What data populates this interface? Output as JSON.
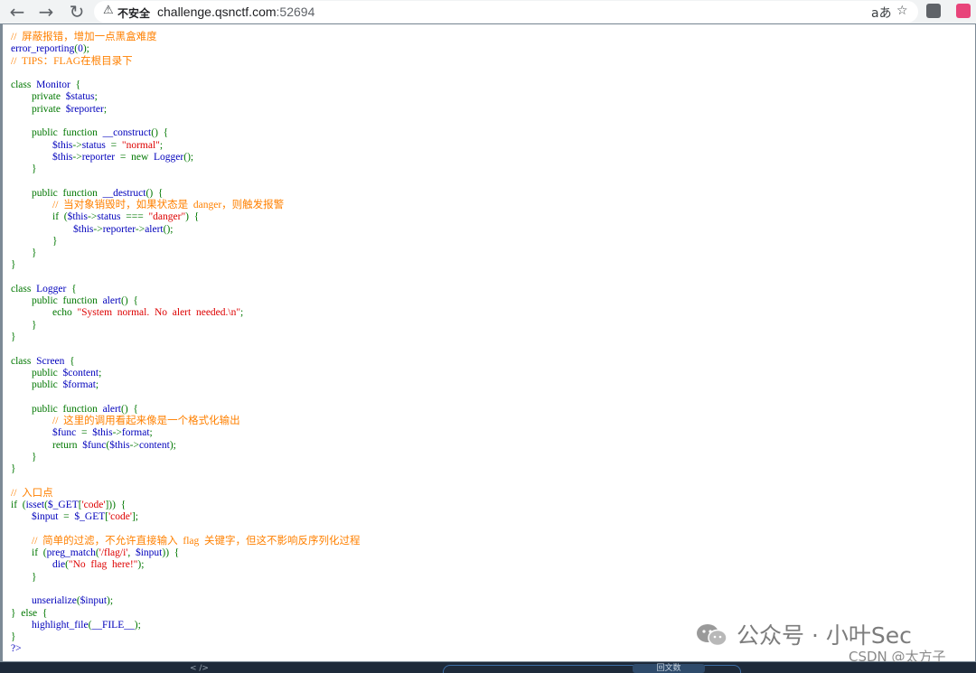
{
  "browser": {
    "security_label": "不安全",
    "url_host": "challenge.qsnctf.com",
    "url_port": ":52694",
    "translate_icon": "translate-icon",
    "bookmark_icon": "star-icon"
  },
  "code_lines": [
    [
      [
        "cm",
        "//  屏蔽报错，增加一点黑盒难度"
      ]
    ],
    [
      [
        "df",
        "error_reporting"
      ],
      [
        "kw",
        "("
      ],
      [
        "df",
        "0"
      ],
      [
        "kw",
        ");"
      ]
    ],
    [
      [
        "cm",
        "//  TIPS：FLAG在根目录下"
      ]
    ],
    [],
    [
      [
        "kw",
        "class  "
      ],
      [
        "df",
        "Monitor  "
      ],
      [
        "kw",
        "{"
      ]
    ],
    [
      [
        "kw",
        "        private  "
      ],
      [
        "df",
        "$status"
      ],
      [
        "kw",
        ";"
      ]
    ],
    [
      [
        "kw",
        "        private  "
      ],
      [
        "df",
        "$reporter"
      ],
      [
        "kw",
        ";"
      ]
    ],
    [],
    [
      [
        "kw",
        "        public  function  "
      ],
      [
        "df",
        "__construct"
      ],
      [
        "kw",
        "()  {"
      ]
    ],
    [
      [
        "df",
        "                $this"
      ],
      [
        "kw",
        "->"
      ],
      [
        "df",
        "status  "
      ],
      [
        "kw",
        "=  "
      ],
      [
        "st",
        "\"normal\""
      ],
      [
        "kw",
        ";"
      ]
    ],
    [
      [
        "df",
        "                $this"
      ],
      [
        "kw",
        "->"
      ],
      [
        "df",
        "reporter  "
      ],
      [
        "kw",
        "=  new  "
      ],
      [
        "df",
        "Logger"
      ],
      [
        "kw",
        "();"
      ]
    ],
    [
      [
        "kw",
        "        }"
      ]
    ],
    [],
    [
      [
        "kw",
        "        public  function  "
      ],
      [
        "df",
        "__destruct"
      ],
      [
        "kw",
        "()  {"
      ]
    ],
    [
      [
        "cm",
        "                //  当对象销毁时，如果状态是  danger，则触发报警"
      ]
    ],
    [
      [
        "kw",
        "                if  ("
      ],
      [
        "df",
        "$this"
      ],
      [
        "kw",
        "->"
      ],
      [
        "df",
        "status  "
      ],
      [
        "kw",
        "===  "
      ],
      [
        "st",
        "\"danger\""
      ],
      [
        "kw",
        ")  {"
      ]
    ],
    [
      [
        "df",
        "                        $this"
      ],
      [
        "kw",
        "->"
      ],
      [
        "df",
        "reporter"
      ],
      [
        "kw",
        "->"
      ],
      [
        "df",
        "alert"
      ],
      [
        "kw",
        "();"
      ]
    ],
    [
      [
        "kw",
        "                }"
      ]
    ],
    [
      [
        "kw",
        "        }"
      ]
    ],
    [
      [
        "kw",
        "}"
      ]
    ],
    [],
    [
      [
        "kw",
        "class  "
      ],
      [
        "df",
        "Logger  "
      ],
      [
        "kw",
        "{"
      ]
    ],
    [
      [
        "kw",
        "        public  function  "
      ],
      [
        "df",
        "alert"
      ],
      [
        "kw",
        "()  {"
      ]
    ],
    [
      [
        "kw",
        "                echo  "
      ],
      [
        "st",
        "\"System  normal.  No  alert  needed.\\n\""
      ],
      [
        "kw",
        ";"
      ]
    ],
    [
      [
        "kw",
        "        }"
      ]
    ],
    [
      [
        "kw",
        "}"
      ]
    ],
    [],
    [
      [
        "kw",
        "class  "
      ],
      [
        "df",
        "Screen  "
      ],
      [
        "kw",
        "{"
      ]
    ],
    [
      [
        "kw",
        "        public  "
      ],
      [
        "df",
        "$content"
      ],
      [
        "kw",
        ";"
      ]
    ],
    [
      [
        "kw",
        "        public  "
      ],
      [
        "df",
        "$format"
      ],
      [
        "kw",
        ";"
      ]
    ],
    [],
    [
      [
        "kw",
        "        public  function  "
      ],
      [
        "df",
        "alert"
      ],
      [
        "kw",
        "()  {"
      ]
    ],
    [
      [
        "cm",
        "                //  这里的调用看起来像是一个格式化输出"
      ]
    ],
    [
      [
        "df",
        "                $func  "
      ],
      [
        "kw",
        "=  "
      ],
      [
        "df",
        "$this"
      ],
      [
        "kw",
        "->"
      ],
      [
        "df",
        "format"
      ],
      [
        "kw",
        ";"
      ]
    ],
    [
      [
        "kw",
        "                return  "
      ],
      [
        "df",
        "$func"
      ],
      [
        "kw",
        "("
      ],
      [
        "df",
        "$this"
      ],
      [
        "kw",
        "->"
      ],
      [
        "df",
        "content"
      ],
      [
        "kw",
        ");"
      ]
    ],
    [
      [
        "kw",
        "        }"
      ]
    ],
    [
      [
        "kw",
        "}"
      ]
    ],
    [],
    [
      [
        "cm",
        "//  入口点"
      ]
    ],
    [
      [
        "kw",
        "if  ("
      ],
      [
        "df",
        "isset"
      ],
      [
        "kw",
        "("
      ],
      [
        "df",
        "$_GET"
      ],
      [
        "kw",
        "["
      ],
      [
        "st",
        "'code'"
      ],
      [
        "kw",
        "]))  {"
      ]
    ],
    [
      [
        "df",
        "        $input  "
      ],
      [
        "kw",
        "=  "
      ],
      [
        "df",
        "$_GET"
      ],
      [
        "kw",
        "["
      ],
      [
        "st",
        "'code'"
      ],
      [
        "kw",
        "];"
      ]
    ],
    [],
    [
      [
        "cm",
        "        //  简单的过滤，不允许直接输入  flag  关键字，但这不影响反序列化过程"
      ]
    ],
    [
      [
        "kw",
        "        if  ("
      ],
      [
        "df",
        "preg_match"
      ],
      [
        "kw",
        "("
      ],
      [
        "st",
        "'/flag/i'"
      ],
      [
        "kw",
        ",  "
      ],
      [
        "df",
        "$input"
      ],
      [
        "kw",
        "))  {"
      ]
    ],
    [
      [
        "df",
        "                die"
      ],
      [
        "kw",
        "("
      ],
      [
        "st",
        "\"No  flag  here!\""
      ],
      [
        "kw",
        ");"
      ]
    ],
    [
      [
        "kw",
        "        }"
      ]
    ],
    [],
    [
      [
        "df",
        "        unserialize"
      ],
      [
        "kw",
        "("
      ],
      [
        "df",
        "$input"
      ],
      [
        "kw",
        ");"
      ]
    ],
    [
      [
        "kw",
        "}  else  {"
      ]
    ],
    [
      [
        "df",
        "        highlight_file"
      ],
      [
        "kw",
        "("
      ],
      [
        "df",
        "__FILE__"
      ],
      [
        "kw",
        ");"
      ]
    ],
    [
      [
        "kw",
        "}"
      ]
    ],
    [
      [
        "df",
        "?>"
      ]
    ]
  ],
  "watermark": {
    "text": "公众号 · 小叶Sec",
    "csdn": "CSDN @太方子"
  },
  "bottom": {
    "tab_label": "< />",
    "center_label": "回文数"
  },
  "colors": {
    "comment": "#ff8000",
    "keyword": "#007700",
    "default": "#0000bb",
    "string": "#dd0000"
  }
}
